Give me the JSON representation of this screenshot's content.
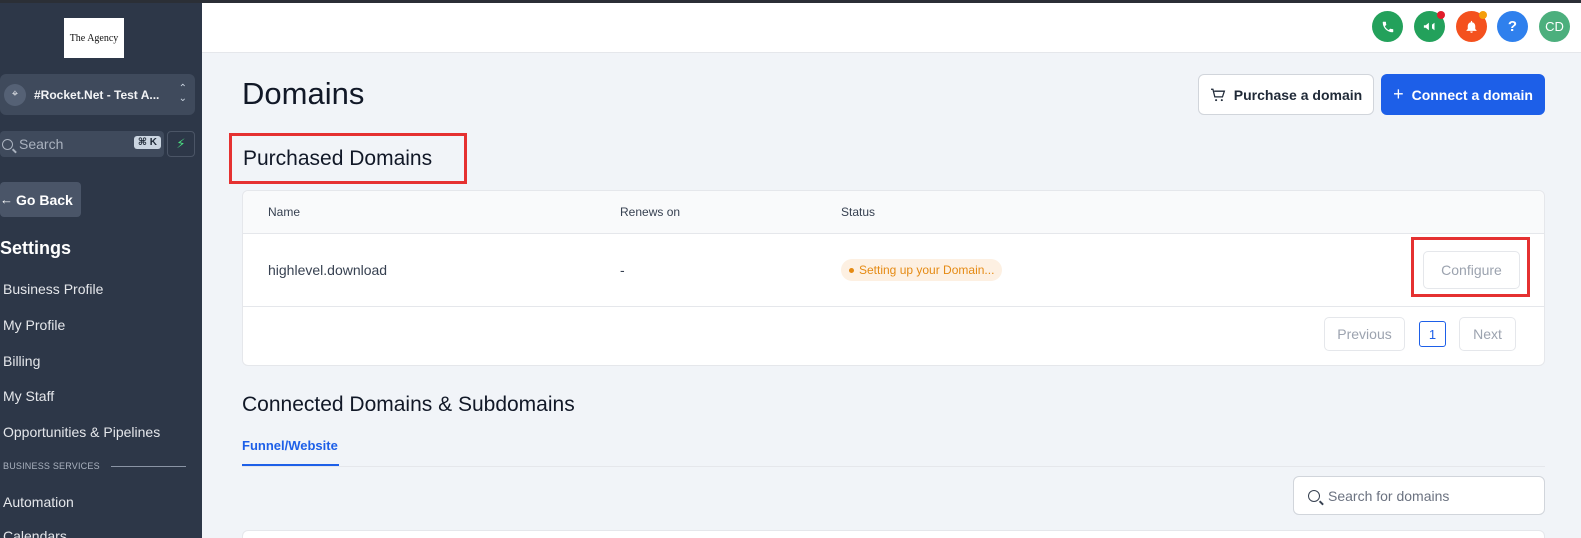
{
  "sidebar": {
    "logo_text": "The Agency",
    "account_name": "#Rocket.Net - Test A...",
    "search_placeholder": "Search",
    "search_shortcut": "⌘ K",
    "go_back": "Go Back",
    "settings_title": "Settings",
    "nav": [
      {
        "label": "Business Profile"
      },
      {
        "label": "My Profile"
      },
      {
        "label": "Billing"
      },
      {
        "label": "My Staff"
      },
      {
        "label": "Opportunities & Pipelines"
      }
    ],
    "section_label": "BUSINESS SERVICES",
    "nav2": [
      {
        "label": "Automation"
      },
      {
        "label": "Calendars"
      }
    ]
  },
  "header": {
    "icons": [
      {
        "name": "phone-icon",
        "color": "#23a15b"
      },
      {
        "name": "megaphone-icon",
        "color": "#23a15b",
        "badge_color": "#e11d2a"
      },
      {
        "name": "bell-icon",
        "color": "#f4511e",
        "badge_color": "#f59e0b"
      },
      {
        "name": "help-icon",
        "color": "#2f80ed",
        "glyph": "?"
      },
      {
        "name": "avatar",
        "color": "#4caf7d",
        "initials": "CD"
      }
    ]
  },
  "main": {
    "title": "Domains",
    "purchase_button": "Purchase a domain",
    "connect_button": "Connect a domain",
    "purchased_title": "Purchased Domains",
    "columns": [
      "Name",
      "Renews on",
      "Status"
    ],
    "rows": [
      {
        "name": "highlevel.download",
        "renews_on": "-",
        "status": "Setting up your Domain...",
        "action": "Configure"
      }
    ],
    "pagination": {
      "previous": "Previous",
      "page": "1",
      "next": "Next"
    },
    "connected_title": "Connected Domains & Subdomains",
    "tab": "Funnel/Website",
    "search_placeholder": "Search for domains"
  },
  "colors": {
    "sidebar_bg": "#2d3748",
    "primary": "#1d5fe8",
    "highlight": "#e53131",
    "status_warning": "#e58a13"
  }
}
